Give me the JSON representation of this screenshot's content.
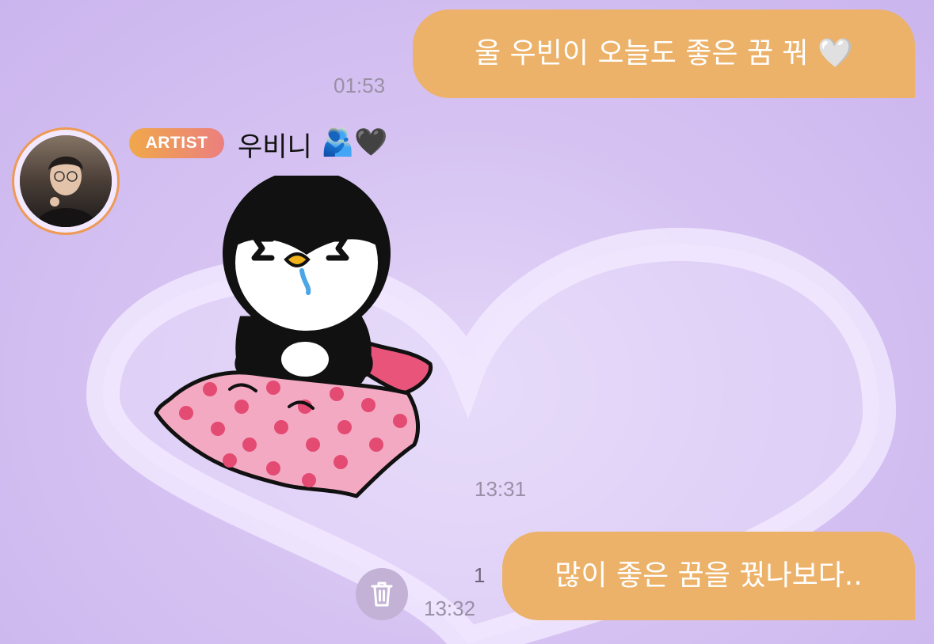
{
  "messages": {
    "first": {
      "text": "울 우빈이 오늘도 좋은 꿈 꿔 🤍",
      "time": "01:53"
    },
    "artist_reply": {
      "badge": "ARTIST",
      "sender": "우비니",
      "sender_emoji": "🫂🖤",
      "sticker": "penguin-blanket-sticker",
      "time": "13:31"
    },
    "last": {
      "text": "많이 좋은 꿈을 꿨나보다..",
      "time": "13:32",
      "unread_count": "1"
    }
  },
  "actions": {
    "delete_icon": "trash-icon"
  },
  "colors": {
    "bubble": "#ecb269",
    "background": "#d6c3f2",
    "badge_start": "#f0a84a",
    "badge_end": "#eb7f7f",
    "avatar_ring": "#ee9a55"
  }
}
